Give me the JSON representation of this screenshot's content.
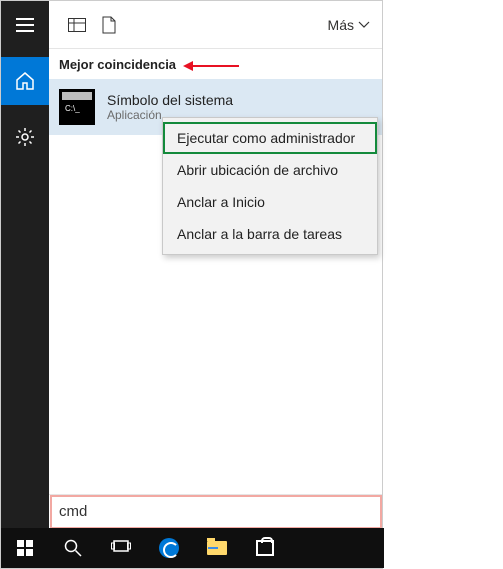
{
  "topbar": {
    "mas_label": "Más"
  },
  "section_label": "Mejor coincidencia",
  "result": {
    "title": "Símbolo del sistema",
    "subtitle": "Aplicación"
  },
  "context_menu": {
    "items": [
      "Ejecutar como administrador",
      "Abrir ubicación de archivo",
      "Anclar a Inicio",
      "Anclar a la barra de tareas"
    ]
  },
  "search": {
    "value": "cmd"
  }
}
